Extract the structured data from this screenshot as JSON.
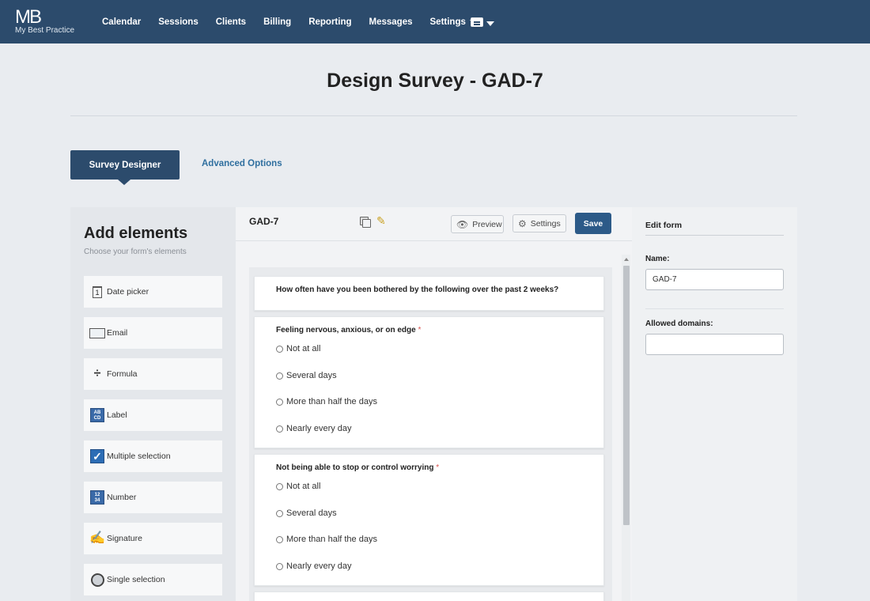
{
  "nav": {
    "logo_mark": "MB",
    "logo_text": "My Best Practice",
    "items": [
      "Calendar",
      "Sessions",
      "Clients",
      "Billing",
      "Reporting",
      "Messages",
      "Settings"
    ],
    "account_icon": "id-card-icon"
  },
  "page": {
    "title": "Design Survey - GAD-7"
  },
  "tabs": {
    "active": "Survey Designer",
    "other": "Advanced Options"
  },
  "add_elements": {
    "title": "Add elements",
    "subtitle": "Choose your form's elements",
    "items": [
      {
        "label": "Date picker",
        "icon": "calendar-icon"
      },
      {
        "label": "Email",
        "icon": "envelope-icon"
      },
      {
        "label": "Formula",
        "icon": "divide-icon"
      },
      {
        "label": "Label",
        "icon": "label-icon"
      },
      {
        "label": "Multiple selection",
        "icon": "checkbox-icon"
      },
      {
        "label": "Number",
        "icon": "number-icon"
      },
      {
        "label": "Signature",
        "icon": "signature-icon"
      },
      {
        "label": "Single selection",
        "icon": "radio-icon"
      }
    ]
  },
  "designer": {
    "form_name": "GAD-7",
    "preview_label": "Preview",
    "settings_label": "Settings",
    "save_label": "Save",
    "intro": "How often have you been bothered by the following over the past 2 weeks?",
    "questions": [
      {
        "text": "Feeling nervous, anxious, or on edge",
        "required_mark": "*",
        "options": [
          "Not at all",
          "Several days",
          "More than half the days",
          "Nearly every day"
        ]
      },
      {
        "text": "Not being able to stop or control worrying",
        "required_mark": "*",
        "options": [
          "Not at all",
          "Several days",
          "More than half the days",
          "Nearly every day"
        ]
      }
    ]
  },
  "edit_form": {
    "title": "Edit form",
    "name_label": "Name:",
    "name_value": "GAD-7",
    "domains_label": "Allowed domains:",
    "domains_value": ""
  },
  "colors": {
    "nav_bg": "#2c4b6c",
    "accent": "#2c5a88",
    "link": "#2f6f9f",
    "required": "#d9534f"
  }
}
